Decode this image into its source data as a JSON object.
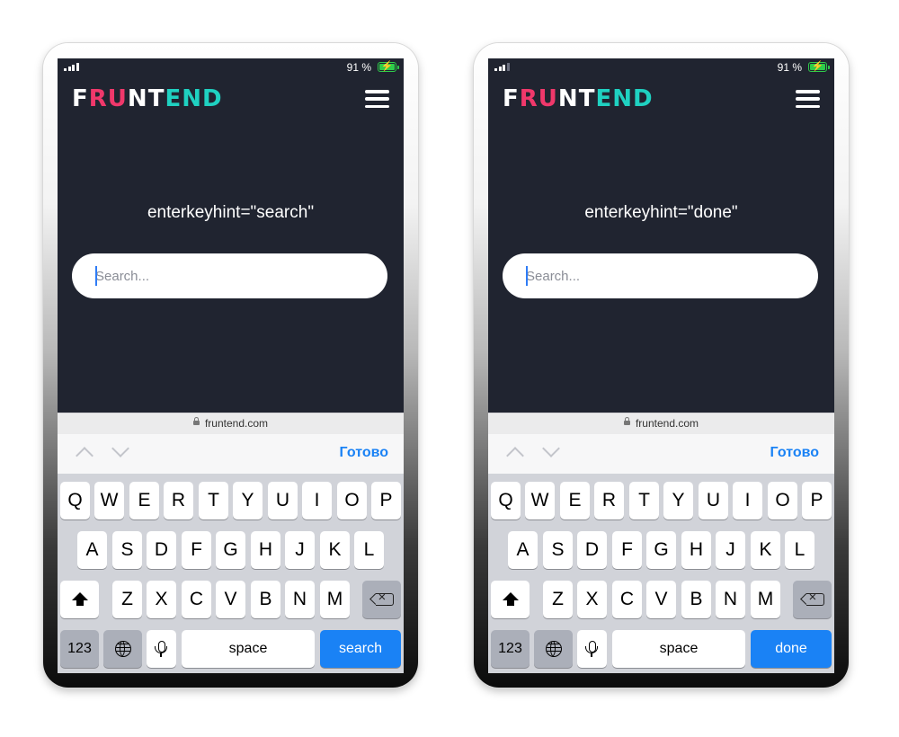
{
  "phones": [
    {
      "status": {
        "battery_percent": "91 %"
      },
      "logo": {
        "letters": [
          "F",
          "R",
          "U",
          "N",
          "T",
          "E",
          "N",
          "D"
        ]
      },
      "hint_text": "enterkeyhint=\"search\"",
      "search": {
        "placeholder": "Search..."
      },
      "url": "fruntend.com",
      "toolbar": {
        "done_label": "Готово"
      },
      "keyboard": {
        "row1": [
          "Q",
          "W",
          "E",
          "R",
          "T",
          "Y",
          "U",
          "I",
          "O",
          "P"
        ],
        "row2": [
          "A",
          "S",
          "D",
          "F",
          "G",
          "H",
          "J",
          "K",
          "L"
        ],
        "row3": [
          "Z",
          "X",
          "C",
          "V",
          "B",
          "N",
          "M"
        ],
        "numbers_label": "123",
        "space_label": "space",
        "return_label": "search"
      }
    },
    {
      "status": {
        "battery_percent": "91 %"
      },
      "logo": {
        "letters": [
          "F",
          "R",
          "U",
          "N",
          "T",
          "E",
          "N",
          "D"
        ]
      },
      "hint_text": "enterkeyhint=\"done\"",
      "search": {
        "placeholder": "Search..."
      },
      "url": "fruntend.com",
      "toolbar": {
        "done_label": "Готово"
      },
      "keyboard": {
        "row1": [
          "Q",
          "W",
          "E",
          "R",
          "T",
          "Y",
          "U",
          "I",
          "O",
          "P"
        ],
        "row2": [
          "A",
          "S",
          "D",
          "F",
          "G",
          "H",
          "J",
          "K",
          "L"
        ],
        "row3": [
          "Z",
          "X",
          "C",
          "V",
          "B",
          "N",
          "M"
        ],
        "numbers_label": "123",
        "space_label": "space",
        "return_label": "done"
      }
    }
  ],
  "colors": {
    "background": "#202430",
    "logo_pink": "#f0386b",
    "logo_teal": "#1fd1c1",
    "accent_blue": "#1a82f5",
    "battery_green": "#2ecc4a",
    "keyboard_bg": "#d1d3d9"
  },
  "icons": [
    "signal-icon",
    "battery-icon",
    "menu-icon",
    "lock-icon",
    "chevron-up-icon",
    "chevron-down-icon",
    "shift-icon",
    "backspace-icon",
    "globe-icon",
    "mic-icon"
  ]
}
